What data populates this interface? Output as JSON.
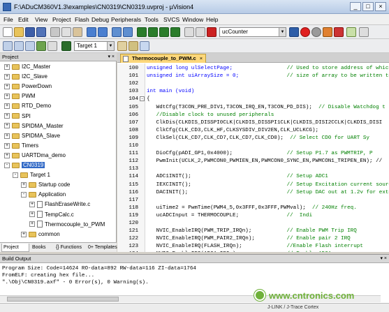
{
  "window": {
    "title": "F:\\ADuCM360V1.3\\examples\\CN0319\\CN0319.uvproj - µVision4"
  },
  "menu": [
    "File",
    "Edit",
    "View",
    "Project",
    "Flash",
    "Debug",
    "Peripherals",
    "Tools",
    "SVCS",
    "Window",
    "Help"
  ],
  "toolbar": {
    "find_combo": "ucCounter",
    "target_combo": "Target 1"
  },
  "project_panel": {
    "title": "Project",
    "items": [
      {
        "label": "I2C_Master",
        "indent": 1,
        "type": "folder",
        "expand": "+"
      },
      {
        "label": "I2C_Slave",
        "indent": 1,
        "type": "folder",
        "expand": "+"
      },
      {
        "label": "PowerDown",
        "indent": 1,
        "type": "folder",
        "expand": "+"
      },
      {
        "label": "PWM",
        "indent": 1,
        "type": "folder",
        "expand": "+"
      },
      {
        "label": "RTD_Demo",
        "indent": 1,
        "type": "folder",
        "expand": "+"
      },
      {
        "label": "SPI",
        "indent": 1,
        "type": "folder",
        "expand": "+"
      },
      {
        "label": "SPIDMA_Master",
        "indent": 1,
        "type": "folder",
        "expand": "+"
      },
      {
        "label": "SPIDMA_Slave",
        "indent": 1,
        "type": "folder",
        "expand": "+"
      },
      {
        "label": "Timers",
        "indent": 1,
        "type": "folder",
        "expand": "+"
      },
      {
        "label": "UARTDma_demo",
        "indent": 1,
        "type": "folder",
        "expand": "+"
      },
      {
        "label": "CN0319",
        "indent": 1,
        "type": "folder",
        "expand": "-",
        "selected": true
      },
      {
        "label": "Target 1",
        "indent": 2,
        "type": "folder",
        "expand": "-"
      },
      {
        "label": "Startup code",
        "indent": 3,
        "type": "folder",
        "expand": "+"
      },
      {
        "label": "Application",
        "indent": 3,
        "type": "folder",
        "expand": "-"
      },
      {
        "label": "FlashEraseWrite.c",
        "indent": 4,
        "type": "file",
        "expand": "+"
      },
      {
        "label": "TempCalc.c",
        "indent": 4,
        "type": "file",
        "expand": "+"
      },
      {
        "label": "Thermocouple_to_PWM",
        "indent": 4,
        "type": "file",
        "expand": "+"
      },
      {
        "label": "common",
        "indent": 3,
        "type": "folder",
        "expand": "+"
      }
    ],
    "tabs": [
      "Project",
      "Books",
      "{} Functions",
      "0+ Templates"
    ]
  },
  "editor": {
    "tab_label": "Thermocouple_to_PWM.c",
    "lines": [
      {
        "n": "100",
        "code": "unsigned long ulSelectPage;",
        "comment": "// Used to store address of whic"
      },
      {
        "n": "101",
        "code": "unsigned int uiArraySize = 0;",
        "comment": "// size of array to be written to fl"
      },
      {
        "n": "102",
        "code": "",
        "comment": ""
      },
      {
        "n": "103",
        "code": "int main (void)",
        "comment": ""
      },
      {
        "n": "104",
        "code": "{",
        "comment": "",
        "fold": "-"
      },
      {
        "n": "105",
        "code": "   WdtCfg(T3CON_PRE_DIV1,T3CON_IRQ_EN,T3CON_PD_DIS);",
        "comment": "// Disable Watchdog t"
      },
      {
        "n": "106",
        "code": "   ",
        "comment": "//Disable clock to unused peripherals"
      },
      {
        "n": "107",
        "code": "   ClkDis(CLKDIS_DISSPI0CLK|CLKDIS_DISSPI1CLK|CLKDIS_DISI2CCLK|CLKDIS_DISI",
        "comment": ""
      },
      {
        "n": "108",
        "code": "   ClkCfg(CLK_CD3,CLK_HF,CLKSYSDIV_DIV2EN,CLK_UCLKCG);",
        "comment": ""
      },
      {
        "n": "109",
        "code": "   ClkSel(CLK_CD7,CLK_CD7,CLK_CD7,CLK_CD0);",
        "comment": "// Select CD0 for UART Sy"
      },
      {
        "n": "110",
        "code": "",
        "comment": ""
      },
      {
        "n": "111",
        "code": "   DioCfg(pADI_GP1,0x4000);",
        "comment": "// Setup P1.7 as PWMTRIP, P"
      },
      {
        "n": "112",
        "code": "   PwmInit(UCLK_2,PWMCON0_PWMIEN_EN,PWMCON0_SYNC_EN,PWMCON1_TRIPEN_EN); //",
        "comment": ""
      },
      {
        "n": "113",
        "code": "",
        "comment": ""
      },
      {
        "n": "114",
        "code": "   ADC1INIT();",
        "comment": "// Setup ADC1"
      },
      {
        "n": "115",
        "code": "   IEXCINIT();",
        "comment": "// Setup Excitation current source"
      },
      {
        "n": "116",
        "code": "   DACINIT();",
        "comment": "// Setup DAC out at 1.2v for exter"
      },
      {
        "n": "117",
        "code": "",
        "comment": ""
      },
      {
        "n": "118",
        "code": "   uiTime2 = PwmTime(PWM4_5,0x3FFF,0x3FFF,PWMval);",
        "comment": "// 240Hz freq."
      },
      {
        "n": "119",
        "code": "   ucADCInput = THERMOCOUPLE;",
        "comment": "//  Indi"
      },
      {
        "n": "120",
        "code": "",
        "comment": ""
      },
      {
        "n": "121",
        "code": "   NVIC_EnableIRQ(PWM_TRIP_IRQn);",
        "comment": "// Enable PWM Trip IRQ"
      },
      {
        "n": "122",
        "code": "   NVIC_EnableIRQ(PWM_PAIR2_IRQn);",
        "comment": "// Enable pair 2 IRQ"
      },
      {
        "n": "123",
        "code": "   NVIC_EnableIRQ(FLASH_IRQn);",
        "comment": "//Enable Flash interrupt"
      },
      {
        "n": "124",
        "code": "   NVIC_EnableIRQ(ADC1_IRQn);",
        "comment": "// Enable ADC1"
      }
    ]
  },
  "build_output": {
    "title": "Build Output",
    "lines": [
      "Program Size: Code=14624 RO-data=892 RW-data=116 ZI-data=1764",
      "FromELF: creating hex file...",
      "\".\\Obj\\CN0319.axf\" - 0 Error(s), 0 Warning(s)."
    ]
  },
  "status": {
    "debugger": "J-LINK / J-Trace Cortex"
  },
  "watermark": "www.cntronics.com"
}
